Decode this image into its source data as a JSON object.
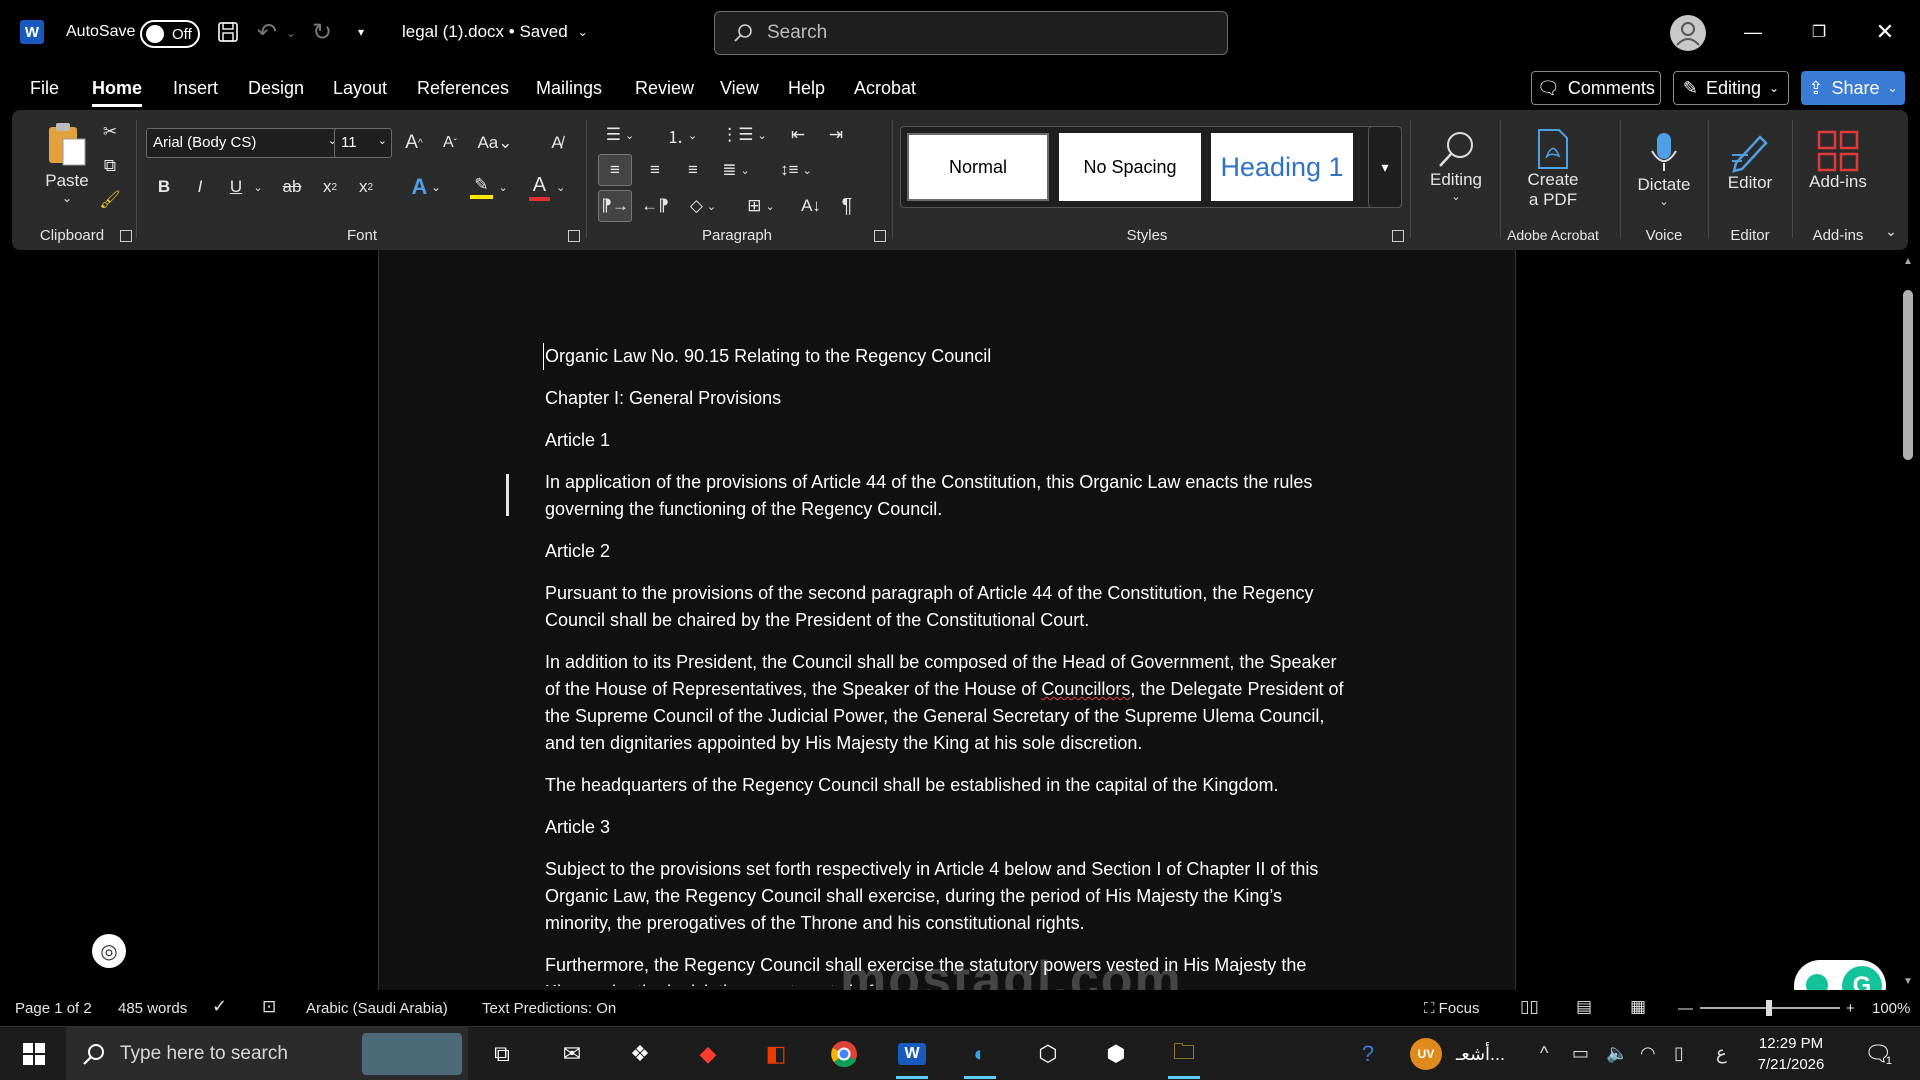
{
  "titlebar": {
    "app_logo": "W",
    "autosave_label": "AutoSave",
    "autosave_state": "Off",
    "doc_title": "legal (1).docx • Saved",
    "search_placeholder": "Search"
  },
  "menu": {
    "tabs": [
      "File",
      "Home",
      "Insert",
      "Design",
      "Layout",
      "References",
      "Mailings",
      "Review",
      "View",
      "Help",
      "Acrobat"
    ],
    "active_tab": "Home",
    "comments_label": "Comments",
    "editing_label": "Editing",
    "share_label": "Share"
  },
  "ribbon": {
    "clipboard": {
      "paste_label": "Paste",
      "group_label": "Clipboard"
    },
    "font": {
      "name": "Arial (Body CS)",
      "size": "11",
      "group_label": "Font"
    },
    "paragraph": {
      "group_label": "Paragraph"
    },
    "styles": {
      "normal": "Normal",
      "no_spacing": "No Spacing",
      "heading1": "Heading 1",
      "group_label": "Styles"
    },
    "editing": {
      "label": "Editing"
    },
    "acrobat": {
      "label_line1": "Create",
      "label_line2": "a PDF",
      "group_label": "Adobe Acrobat"
    },
    "voice": {
      "label": "Dictate",
      "group_label": "Voice"
    },
    "editor": {
      "label": "Editor",
      "group_label": "Editor"
    },
    "addins": {
      "label": "Add-ins",
      "group_label": "Add-ins"
    }
  },
  "document": {
    "paragraphs": [
      "Organic Law No. 90.15 Relating to the Regency Council",
      "Chapter I: General Provisions",
      "Article 1",
      "In application of the provisions of Article 44 of the Constitution, this Organic Law enacts the rules governing the functioning of the Regency Council.",
      "Article 2",
      "Pursuant to the provisions of the second paragraph of Article 44 of the Constitution, the Regency Council shall be chaired by the President of the Constitutional Court.",
      "In addition to its President, the Council shall be composed of the Head of Government, the Speaker of the House of Representatives, the Speaker of the House of ",
      "Councillors",
      ", the Delegate President of the Supreme Council of the Judicial Power, the General Secretary of the Supreme Ulema Council, and ten dignitaries appointed by His Majesty the King at his sole discretion.",
      "The headquarters of the Regency Council shall be established in the capital of the Kingdom.",
      "Article 3",
      "Subject to the provisions set forth respectively in Article 4 below and Section I of Chapter II of this Organic Law, the Regency Council shall exercise, during the period of His Majesty the King’s minority, the prerogatives of the Throne and his constitutional rights.",
      "Furthermore, the Regency Council shall exercise the statutory powers vested in His Majesty the King under the legislative enactments in force."
    ]
  },
  "status": {
    "page": "Page 1 of 2",
    "words": "485 words",
    "language": "Arabic (Saudi Arabia)",
    "predictions": "Text Predictions: On",
    "focus": "Focus",
    "zoom": "100%"
  },
  "watermark": "mostaql.com",
  "taskbar": {
    "search_placeholder": "Type here to search",
    "user_badge": "UV",
    "user_text": "أشعـ...",
    "ime": "ع",
    "time": "12:29 PM",
    "date": "7/21/2026",
    "notification_count": "1"
  },
  "colors": {
    "accent": "#3a7bd5",
    "heading_blue": "#2f73c7",
    "word_blue": "#185abd",
    "grammarly": "#15c39a"
  }
}
